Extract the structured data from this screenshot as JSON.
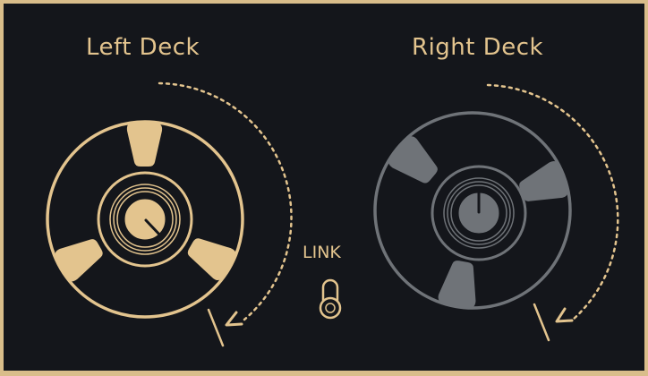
{
  "left_deck": {
    "title": "Left Deck",
    "color": "#e3c48e",
    "active": true,
    "icons": [
      "tape-reel-icon",
      "rotation-arrow-icon",
      "knob-icon"
    ]
  },
  "right_deck": {
    "title": "Right Deck",
    "color": "#6f7378",
    "active": false,
    "icons": [
      "tape-reel-icon",
      "rotation-arrow-icon",
      "knob-icon"
    ]
  },
  "link": {
    "label": "LINK",
    "icon": "toggle-switch-icon"
  },
  "colors": {
    "background": "#14161b",
    "frame": "#d9bd8a",
    "accent": "#e3c48e",
    "inactive": "#6f7378"
  }
}
